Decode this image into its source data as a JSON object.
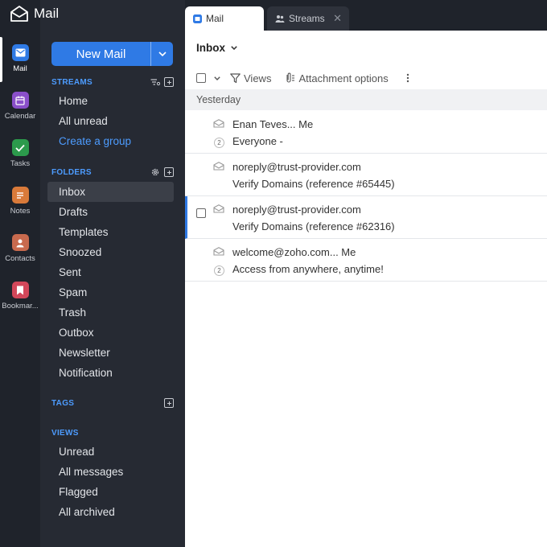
{
  "app": {
    "title": "Mail"
  },
  "rail": {
    "items": [
      {
        "label": "Mail",
        "icon": "mail-app-icon",
        "color": "#2f7ae5"
      },
      {
        "label": "Calendar",
        "icon": "calendar-app-icon",
        "color": "#8a4fc9"
      },
      {
        "label": "Tasks",
        "icon": "tasks-app-icon",
        "color": "#2c9a4c"
      },
      {
        "label": "Notes",
        "icon": "notes-app-icon",
        "color": "#d97a3a"
      },
      {
        "label": "Contacts",
        "icon": "contacts-app-icon",
        "color": "#c86a4e"
      },
      {
        "label": "Bookmar...",
        "icon": "bookmarks-app-icon",
        "color": "#d2475a"
      }
    ]
  },
  "sidebar": {
    "new_mail_label": "New Mail",
    "streams": {
      "header": "STREAMS",
      "items": [
        "Home",
        "All unread",
        "Create a group"
      ]
    },
    "folders": {
      "header": "FOLDERS",
      "items": [
        "Inbox",
        "Drafts",
        "Templates",
        "Snoozed",
        "Sent",
        "Spam",
        "Trash",
        "Outbox",
        "Newsletter",
        "Notification"
      ]
    },
    "tags": {
      "header": "TAGS"
    },
    "views": {
      "header": "VIEWS",
      "items": [
        "Unread",
        "All messages",
        "Flagged",
        "All archived"
      ]
    }
  },
  "tabs": [
    {
      "label": "Mail"
    },
    {
      "label": "Streams"
    }
  ],
  "mail_list": {
    "folder_title": "Inbox",
    "toolbar": {
      "views_label": "Views",
      "attachment_label": "Attachment options"
    },
    "group_label": "Yesterday",
    "rows": [
      {
        "sender": "Enan Teves... Me",
        "subject": "Everyone -",
        "count": "2"
      },
      {
        "sender": "noreply@trust-provider.com",
        "subject": "Verify Domains (reference #65445)",
        "count": ""
      },
      {
        "sender": "noreply@trust-provider.com",
        "subject": "Verify Domains (reference #62316)",
        "count": ""
      },
      {
        "sender": "welcome@zoho.com... Me",
        "subject": "Access from anywhere, anytime!",
        "count": "2"
      }
    ]
  },
  "colors": {
    "accent": "#2f7ae5",
    "rail_bg": "#1f232b",
    "pane_bg": "#262a33",
    "section_header": "#4d9cff"
  }
}
